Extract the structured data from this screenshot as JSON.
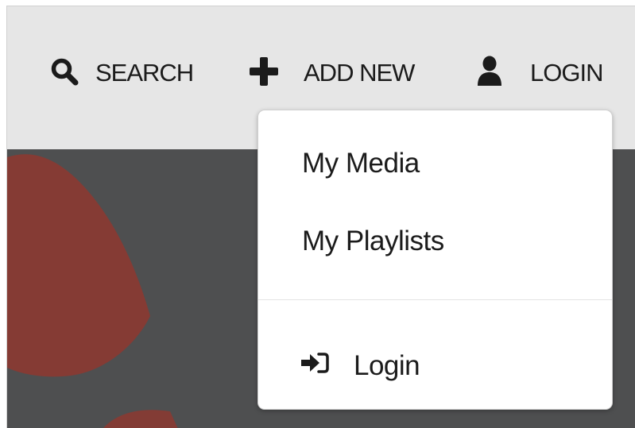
{
  "topbar": {
    "search": {
      "label": "SEARCH",
      "icon": "search-icon"
    },
    "add_new": {
      "label": "ADD NEW",
      "icon": "plus-icon"
    },
    "login": {
      "label": "LOGIN",
      "icon": "user-icon"
    }
  },
  "dropdown": {
    "items": [
      {
        "label": "My Media"
      },
      {
        "label": "My Playlists"
      }
    ],
    "login": {
      "label": "Login",
      "icon": "sign-in-icon"
    }
  },
  "colors": {
    "topbar_bg": "#e6e6e6",
    "hero_bg": "#4e4f50",
    "hero_accent": "#8a3a32",
    "text": "#1b1b1b",
    "menu_bg": "#ffffff"
  }
}
